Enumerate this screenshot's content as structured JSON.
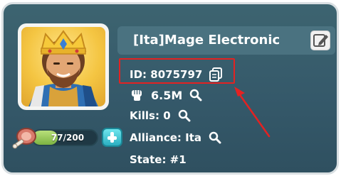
{
  "player": {
    "name": "[Ita]Mage Electronic",
    "id_text": "ID: 8075797",
    "power": "6.5M",
    "kills": "Kills: 0",
    "alliance": "Alliance: Ita",
    "state": "State: #1"
  },
  "stamina": {
    "text": "77/200",
    "fraction": 0.385
  },
  "icons": {
    "edit": "edit-icon",
    "copy": "copy-icon",
    "power": "fist-icon",
    "search": "search-icon",
    "stamina": "meat-icon",
    "add": "plus-icon"
  },
  "colors": {
    "panel": "#35596a",
    "highlight": "#e32222",
    "stamina_fill": "#7cb342",
    "plus_button": "#2aaec0"
  }
}
